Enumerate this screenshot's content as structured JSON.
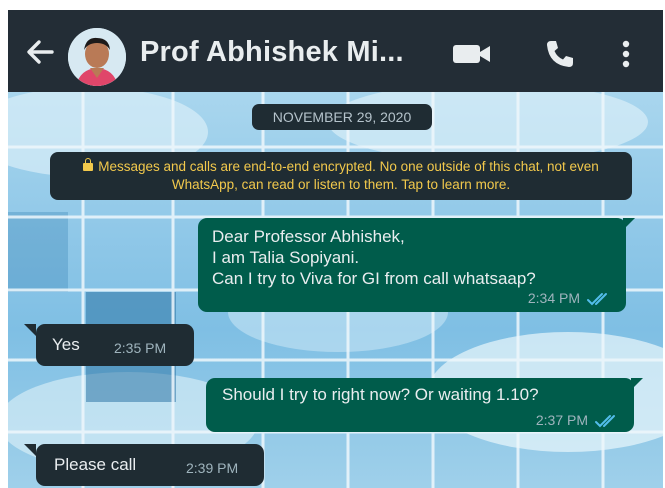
{
  "header": {
    "contact_name": "Prof Abhishek Mi...",
    "icons": [
      "back-arrow-icon",
      "video-call-icon",
      "voice-call-icon",
      "more-options-icon"
    ]
  },
  "chat": {
    "date_chip": "NOVEMBER 29, 2020",
    "encryption_notice": "Messages and calls are end-to-end encrypted. No one outside of this chat, not even WhatsApp, can read or listen to them. Tap to learn more.",
    "messages": [
      {
        "direction": "outgoing",
        "text": "Dear Professor Abhishek,\nI am Talia Sopiyani.\nCan I try to Viva for GI from call whatsaap?",
        "time": "2:34 PM",
        "status": "read"
      },
      {
        "direction": "incoming",
        "text": "Yes",
        "time": "2:35 PM"
      },
      {
        "direction": "outgoing",
        "text": "Should I try to right now? Or waiting 1.10?",
        "time": "2:37 PM",
        "status": "read"
      },
      {
        "direction": "incoming",
        "text": "Please call",
        "time": "2:39 PM"
      }
    ]
  },
  "colors": {
    "header_bg": "#232d36",
    "outgoing_bubble": "#005c4b",
    "incoming_bubble": "#1f2c33",
    "read_ticks": "#53bdeb",
    "encryption_text": "#f2c94c"
  }
}
